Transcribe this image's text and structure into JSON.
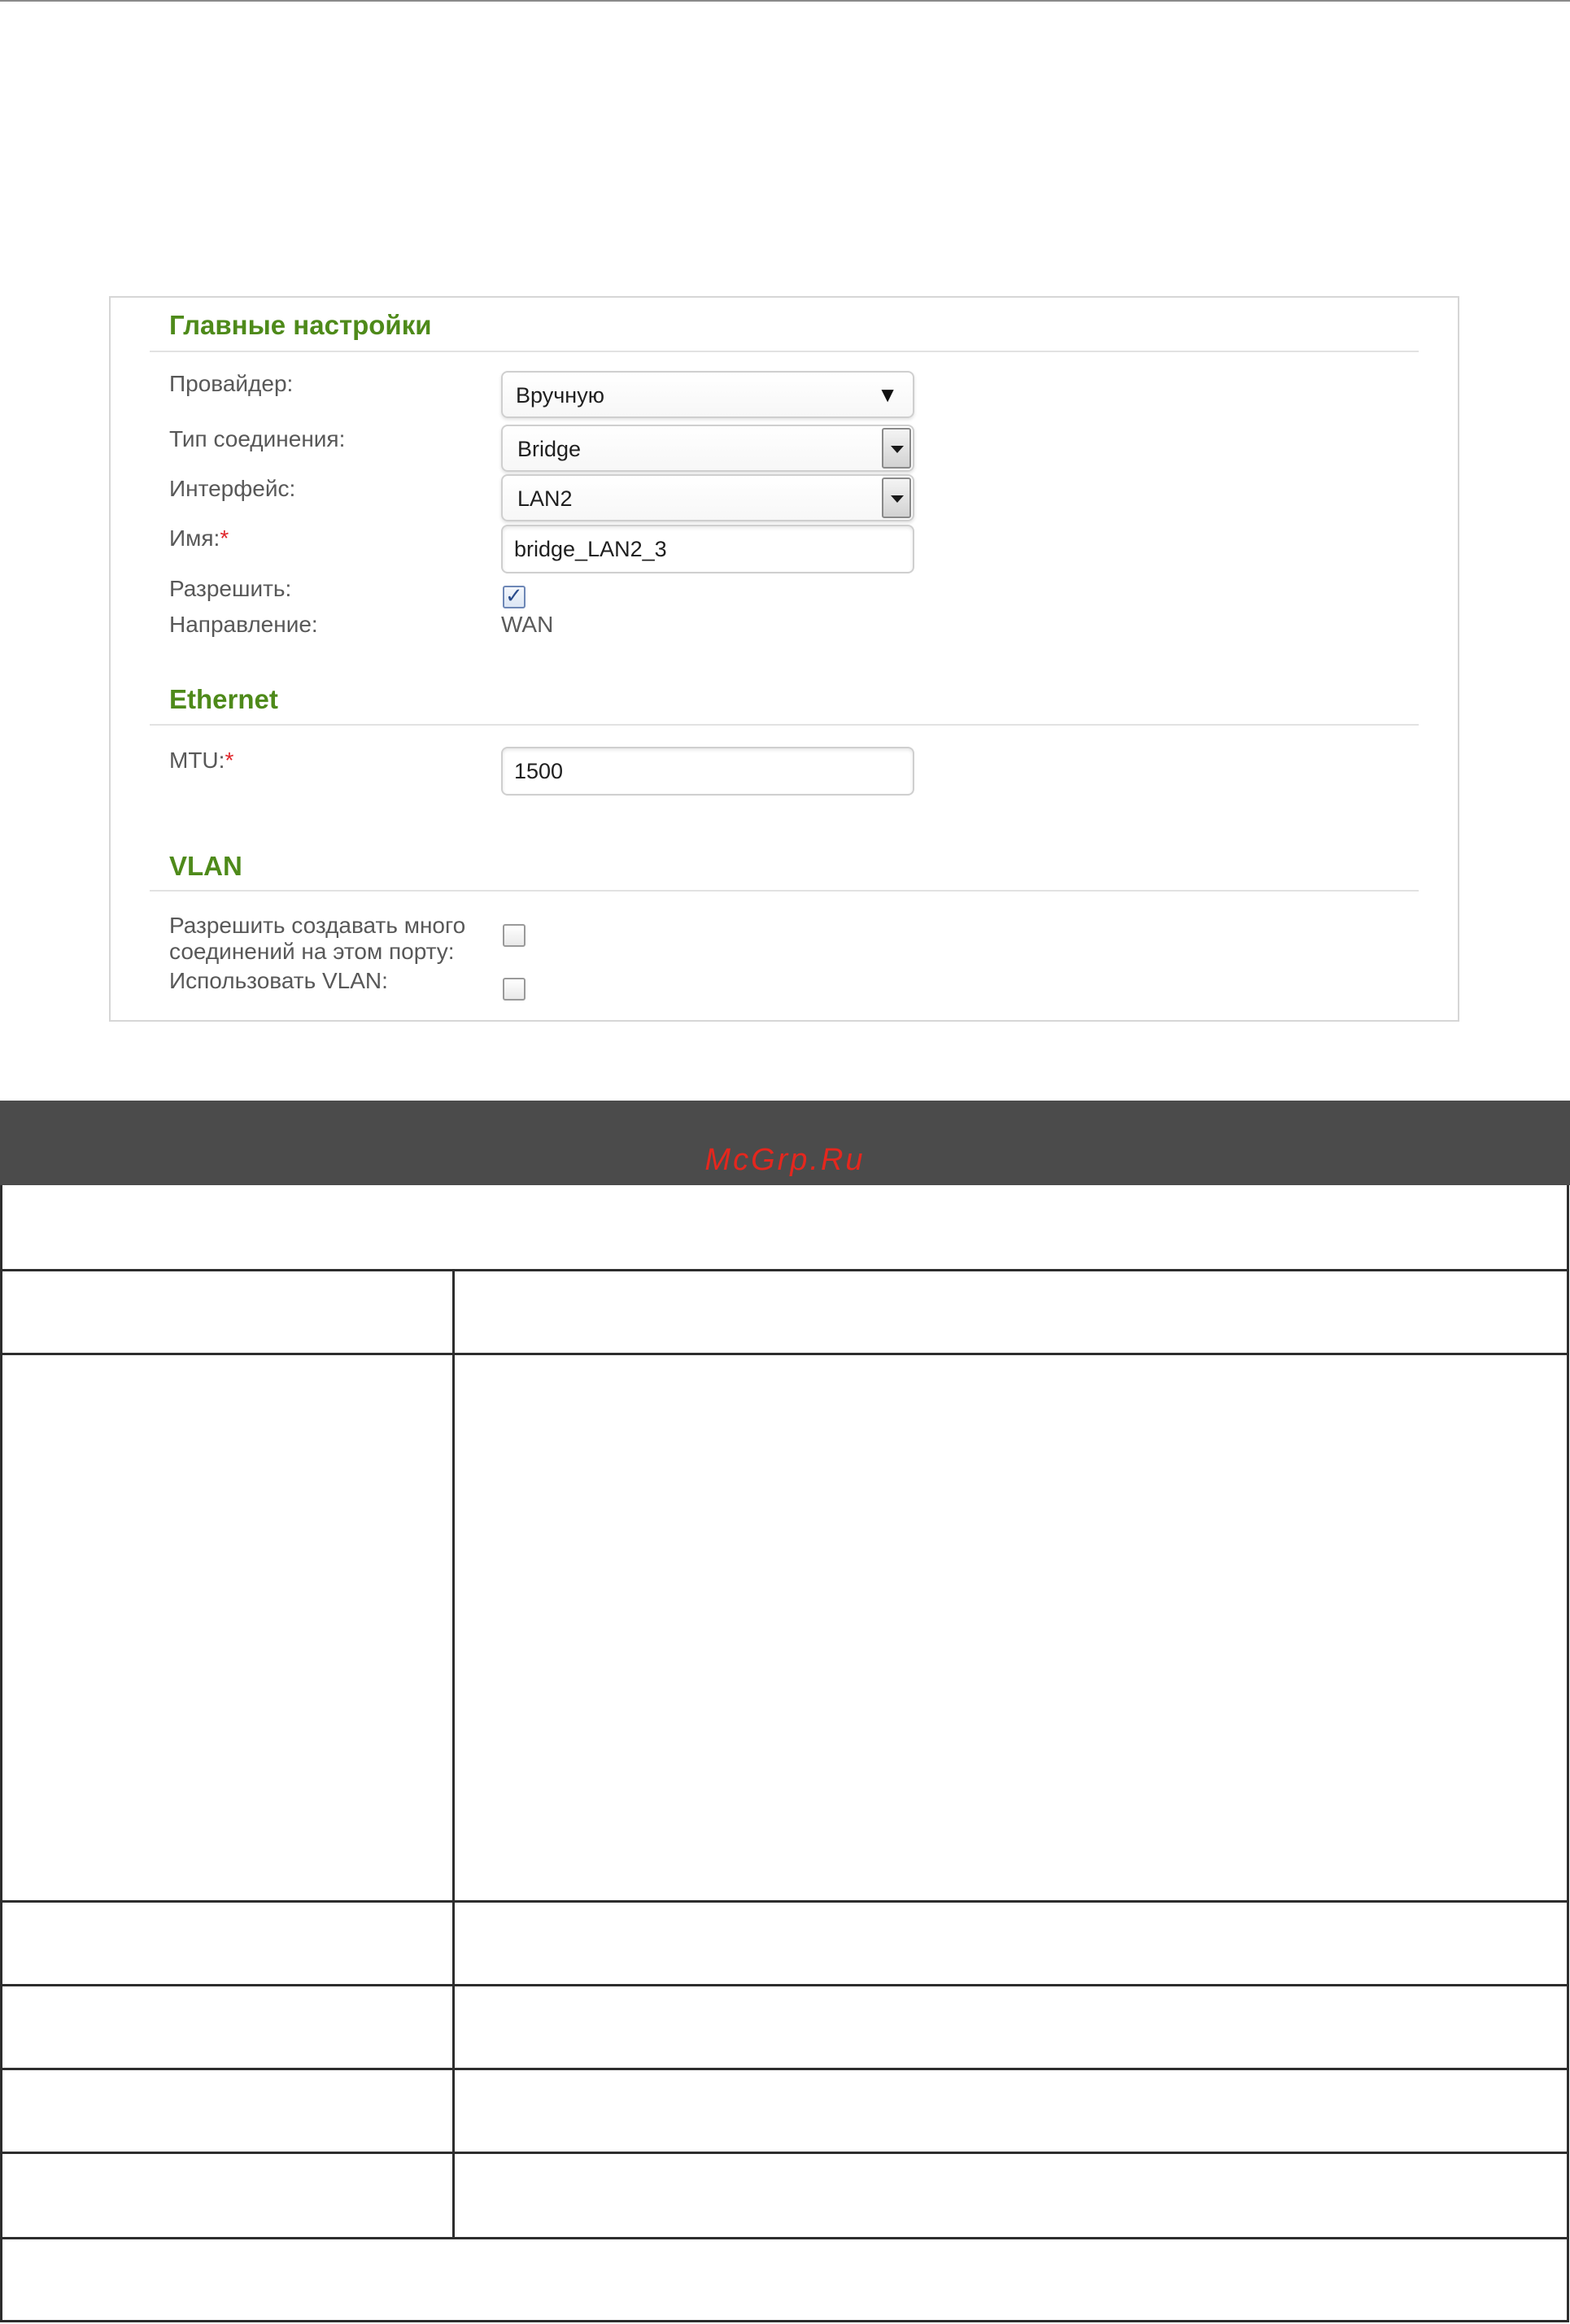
{
  "general": {
    "title": "Главные настройки",
    "provider": {
      "label": "Провайдер:",
      "value": "Вручную"
    },
    "connection_type": {
      "label": "Тип соединения:",
      "value": "Bridge"
    },
    "interface": {
      "label": "Интерфейс:",
      "value": "LAN2"
    },
    "name": {
      "label": "Имя:",
      "required_mark": "*",
      "value": "bridge_LAN2_3"
    },
    "enable": {
      "label": "Разрешить:",
      "checked": true
    },
    "direction": {
      "label": "Направление:",
      "value": "WAN"
    }
  },
  "ethernet": {
    "title": "Ethernet",
    "mtu": {
      "label": "MTU:",
      "required_mark": "*",
      "value": "1500"
    }
  },
  "vlan": {
    "title": "VLAN",
    "multi_connections": {
      "label_line1": "Разрешить создавать много",
      "label_line2": "соединений на этом порту:",
      "checked": false
    },
    "use_vlan": {
      "label": "Использовать VLAN:",
      "checked": false
    }
  },
  "watermark": "McGrp.Ru",
  "icons": {
    "dropdown": "chevron-down-icon",
    "check": "checkmark-icon"
  }
}
